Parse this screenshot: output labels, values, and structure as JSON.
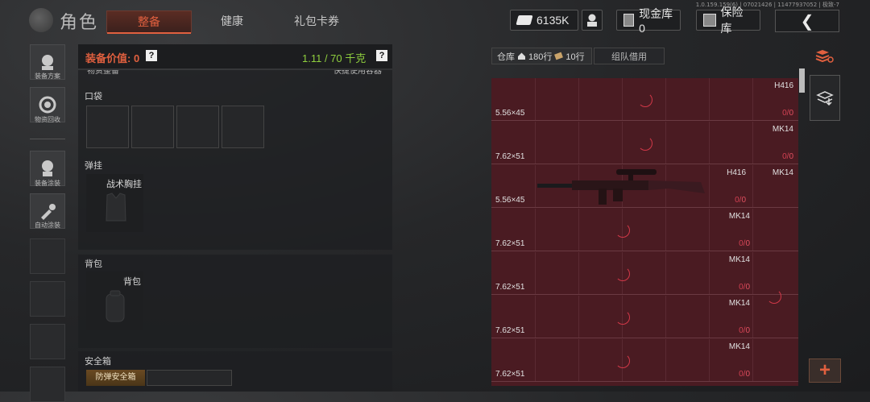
{
  "version_text": "1.0.159.159(6) | 07021426 | 11477937052 | 极致-7",
  "header": {
    "title": "角色",
    "tabs": [
      {
        "label": "整备",
        "active": true
      },
      {
        "label": "健康",
        "active": false
      },
      {
        "label": "礼包卡券",
        "active": false
      }
    ],
    "currency": "6135K",
    "cash_vault": "现金库 0",
    "safe": "保险库"
  },
  "sidebar": {
    "items": [
      {
        "label": "装备方案",
        "icon": "loadout-icon"
      },
      {
        "label": "物资回收",
        "icon": "recycle-icon"
      },
      {
        "label": "装备涂装",
        "icon": "paint-icon"
      },
      {
        "label": "自动涂装",
        "icon": "auto-paint-icon"
      }
    ]
  },
  "equipment": {
    "value_label": "装备价值: 0",
    "weight": "1.11 / 70 千克",
    "top_cut_left": "物资整备",
    "top_cut_right": "快捷使用容器",
    "pockets": "口袋",
    "chest_section": "弹挂",
    "chest_item": "战术胸挂",
    "backpack_section": "背包",
    "backpack_item": "背包",
    "safebox_section": "安全箱",
    "safebox_item": "防弹安全箱"
  },
  "warehouse": {
    "tab_label": "仓库",
    "rows_label": "180行",
    "cols_label": "10行",
    "team_borrow": "组队借用",
    "rows": [
      {
        "caliber": "5.56×45",
        "weapon": "H416",
        "count_a": "0",
        "count_b": "0",
        "second_weapon": ""
      },
      {
        "caliber": "7.62×51",
        "weapon": "MK14",
        "count_a": "0",
        "count_b": "0",
        "second_weapon": ""
      },
      {
        "caliber": "5.56×45",
        "weapon": "H416",
        "count_a": "0",
        "count_b": "0",
        "second_weapon": "MK14"
      },
      {
        "caliber": "7.62×51",
        "weapon": "MK14",
        "count_a": "0",
        "count_b": "0",
        "second_weapon": ""
      },
      {
        "caliber": "7.62×51",
        "weapon": "MK14",
        "count_a": "0",
        "count_b": "0",
        "second_weapon": ""
      },
      {
        "caliber": "7.62×51",
        "weapon": "MK14",
        "count_a": "0",
        "count_b": "0",
        "second_weapon": ""
      },
      {
        "caliber": "7.62×51",
        "weapon": "MK14",
        "count_a": "0",
        "count_b": "0",
        "second_weapon": ""
      }
    ]
  },
  "right_tools": {
    "add_label": "+"
  },
  "colors": {
    "accent": "#e1603f",
    "weight_green": "#8fcf3e",
    "warehouse_bg": "#4a1b22",
    "count_red": "#d24052"
  }
}
